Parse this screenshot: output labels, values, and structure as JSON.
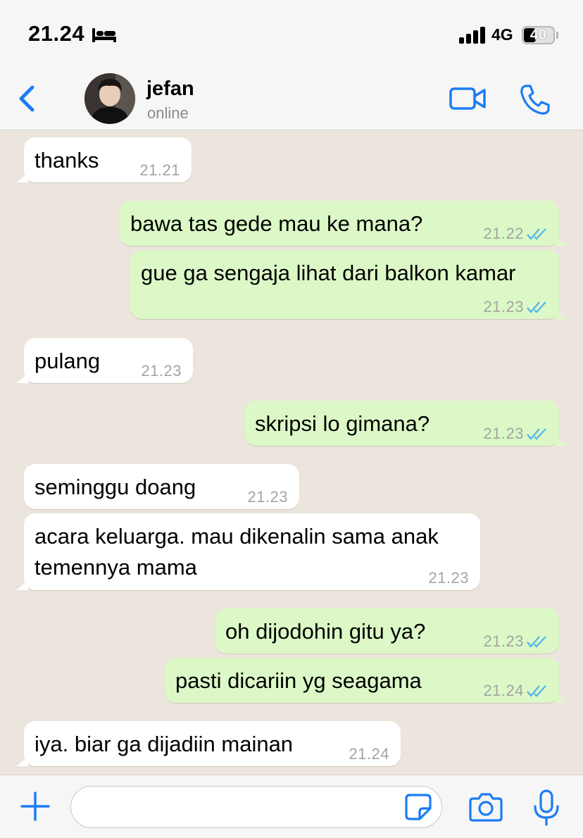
{
  "status_bar": {
    "time": "21.24",
    "network": "4G",
    "battery": "40",
    "icons": [
      "bed-icon",
      "signal-icon",
      "battery-icon"
    ]
  },
  "header": {
    "contact_name": "jefan",
    "contact_status": "online",
    "icons": [
      "back-chevron-icon",
      "avatar",
      "video-camera-icon",
      "phone-icon"
    ],
    "accent_color": "#1b7cf5"
  },
  "messages": [
    {
      "direction": "in",
      "text": "thanks",
      "time": "21.21"
    },
    {
      "direction": "out",
      "text": "bawa tas gede mau ke mana?",
      "time": "21.22",
      "status": "read"
    },
    {
      "direction": "out",
      "text": "gue ga sengaja lihat dari balkon kamar",
      "time": "21.23",
      "status": "read"
    },
    {
      "direction": "in",
      "text": "pulang",
      "time": "21.23"
    },
    {
      "direction": "out",
      "text": "skripsi lo gimana?",
      "time": "21.23",
      "status": "read"
    },
    {
      "direction": "in",
      "text": "seminggu doang",
      "time": "21.23"
    },
    {
      "direction": "in",
      "text_lines": [
        "acara keluarga. mau dikenalin sama anak",
        "temennya mama"
      ],
      "time": "21.23"
    },
    {
      "direction": "out",
      "text": "oh dijodohin gitu ya?",
      "time": "21.23",
      "status": "read"
    },
    {
      "direction": "out",
      "text": "pasti dicariin yg seagama",
      "time": "21.24",
      "status": "read"
    },
    {
      "direction": "in",
      "text": "iya. biar ga dijadiin mainan",
      "time": "21.24"
    }
  ],
  "input_bar": {
    "placeholder": "",
    "icons": [
      "plus-icon",
      "sticker-icon",
      "camera-icon",
      "microphone-icon"
    ]
  },
  "colors": {
    "chat_background": "#ece5dd",
    "incoming_bubble": "#ffffff",
    "outgoing_bubble": "#dcf8c6",
    "read_ticks": "#4fb6ec"
  }
}
